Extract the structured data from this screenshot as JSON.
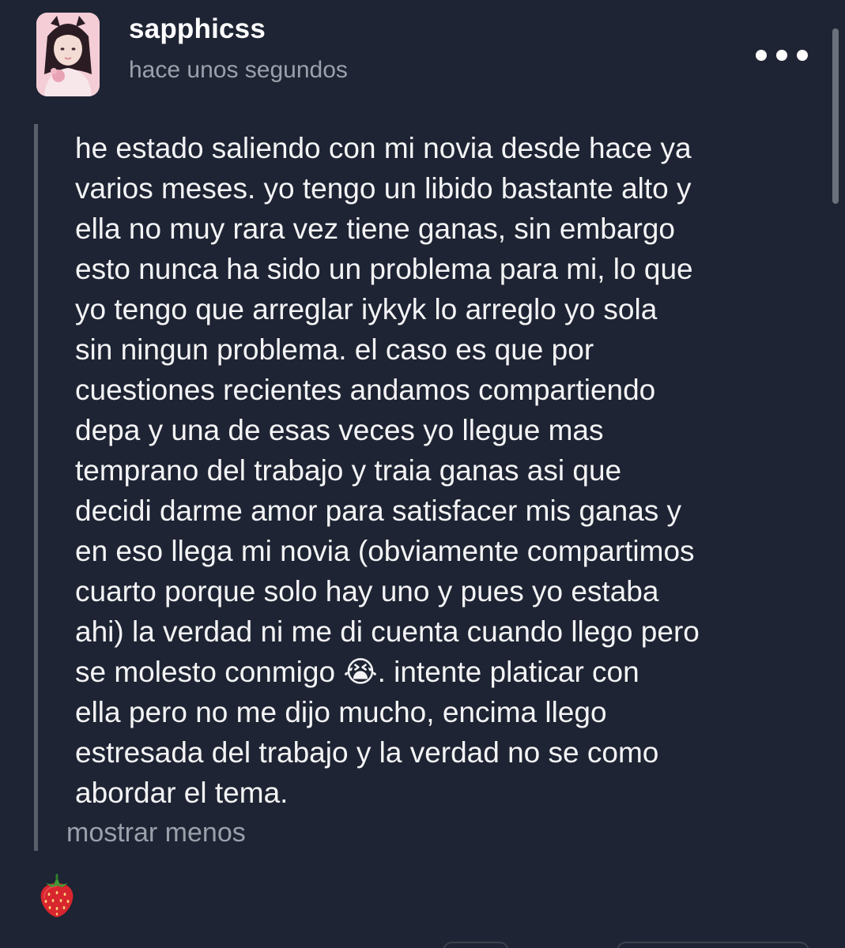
{
  "post": {
    "username": "sapphicss",
    "timestamp": "hace unos segundos",
    "body_lines": [
      "he estado saliendo con mi novia desde hace ya",
      "varios meses. yo tengo un libido bastante alto y",
      "ella no muy rara vez tiene ganas, sin embargo",
      "esto nunca ha sido un problema para mi, lo que",
      "yo tengo que arreglar iykyk lo arreglo yo sola",
      "sin ningun problema. el caso es que por",
      "cuestiones recientes andamos compartiendo",
      "depa y una de esas veces yo llegue mas",
      "temprano del trabajo y traia ganas asi que",
      "decidi darme amor para satisfacer mis ganas y",
      "en eso llega mi novia (obviamente compartimos",
      "cuarto porque solo hay uno y pues yo estaba",
      "ahi) la verdad ni me di cuenta cuando llego pero",
      "se molesto conmigo",
      "ella pero no me dijo mucho, encima llego",
      "estresada del trabajo y la verdad no se como",
      "abordar el tema."
    ],
    "line14_emoji": "😭",
    "line14_tail": ". intente platicar con",
    "show_less": "mostrar menos",
    "tag_emoji": "🍓"
  },
  "icons": {
    "more": "more-horizontal-icon",
    "tag": "strawberry-icon"
  },
  "colors": {
    "background": "#1e2433",
    "text": "#f4f4f6",
    "muted": "#9ba1ab",
    "quote_bar": "#5a606b"
  }
}
